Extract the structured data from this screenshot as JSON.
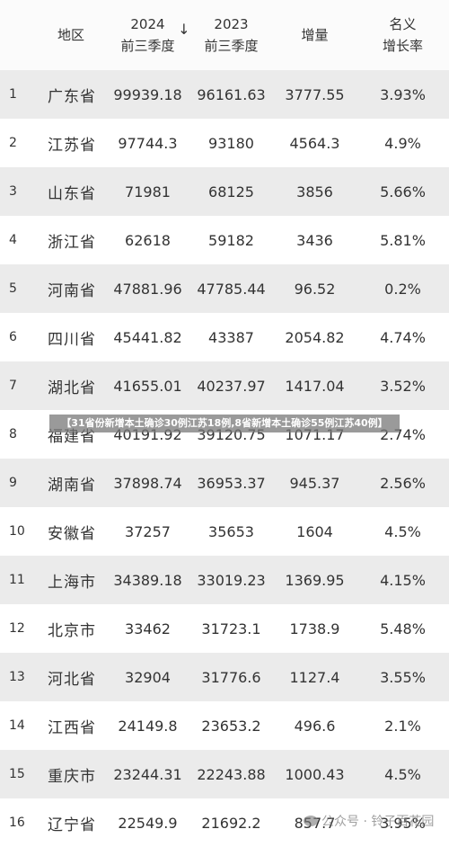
{
  "header": {
    "rank": "",
    "region": "地区",
    "col2024_line1": "2024",
    "col2024_line2": "前三季度",
    "sort_indicator": "↓",
    "col2023_line1": "2023",
    "col2023_line2": "前三季度",
    "increase": "增量",
    "growth_line1": "名义",
    "growth_line2": "增长率"
  },
  "rows": [
    {
      "rank": "1",
      "region": "广东省",
      "y2024": "99939.18",
      "y2023": "96161.63",
      "increase": "3777.55",
      "growth": "3.93%"
    },
    {
      "rank": "2",
      "region": "江苏省",
      "y2024": "97744.3",
      "y2023": "93180",
      "increase": "4564.3",
      "growth": "4.9%"
    },
    {
      "rank": "3",
      "region": "山东省",
      "y2024": "71981",
      "y2023": "68125",
      "increase": "3856",
      "growth": "5.66%"
    },
    {
      "rank": "4",
      "region": "浙江省",
      "y2024": "62618",
      "y2023": "59182",
      "increase": "3436",
      "growth": "5.81%"
    },
    {
      "rank": "5",
      "region": "河南省",
      "y2024": "47881.96",
      "y2023": "47785.44",
      "increase": "96.52",
      "growth": "0.2%"
    },
    {
      "rank": "6",
      "region": "四川省",
      "y2024": "45441.82",
      "y2023": "43387",
      "increase": "2054.82",
      "growth": "4.74%"
    },
    {
      "rank": "7",
      "region": "湖北省",
      "y2024": "41655.01",
      "y2023": "40237.97",
      "increase": "1417.04",
      "growth": "3.52%"
    },
    {
      "rank": "8",
      "region": "福建省",
      "y2024": "40191.92",
      "y2023": "39120.75",
      "increase": "1071.17",
      "growth": "2.74%"
    },
    {
      "rank": "9",
      "region": "湖南省",
      "y2024": "37898.74",
      "y2023": "36953.37",
      "increase": "945.37",
      "growth": "2.56%"
    },
    {
      "rank": "10",
      "region": "安徽省",
      "y2024": "37257",
      "y2023": "35653",
      "increase": "1604",
      "growth": "4.5%"
    },
    {
      "rank": "11",
      "region": "上海市",
      "y2024": "34389.18",
      "y2023": "33019.23",
      "increase": "1369.95",
      "growth": "4.15%"
    },
    {
      "rank": "12",
      "region": "北京市",
      "y2024": "33462",
      "y2023": "31723.1",
      "increase": "1738.9",
      "growth": "5.48%"
    },
    {
      "rank": "13",
      "region": "河北省",
      "y2024": "32904",
      "y2023": "31776.6",
      "increase": "1127.4",
      "growth": "3.55%"
    },
    {
      "rank": "14",
      "region": "江西省",
      "y2024": "24149.8",
      "y2023": "23653.2",
      "increase": "496.6",
      "growth": "2.1%"
    },
    {
      "rank": "15",
      "region": "重庆市",
      "y2024": "23244.31",
      "y2023": "22243.88",
      "increase": "1000.43",
      "growth": "4.5%"
    },
    {
      "rank": "16",
      "region": "辽宁省",
      "y2024": "22549.9",
      "y2023": "21692.2",
      "increase": "857.7",
      "growth": "3.95%"
    }
  ],
  "banner": "【31省份新增本土确诊30例江苏18例,8省新增本土确诊55例江苏40例】",
  "watermark": {
    "icon": "wechat-icon",
    "text": "公众号 · 铃子百花园"
  },
  "colors": {
    "alt_row": "#ebebeb",
    "text": "#333333"
  }
}
